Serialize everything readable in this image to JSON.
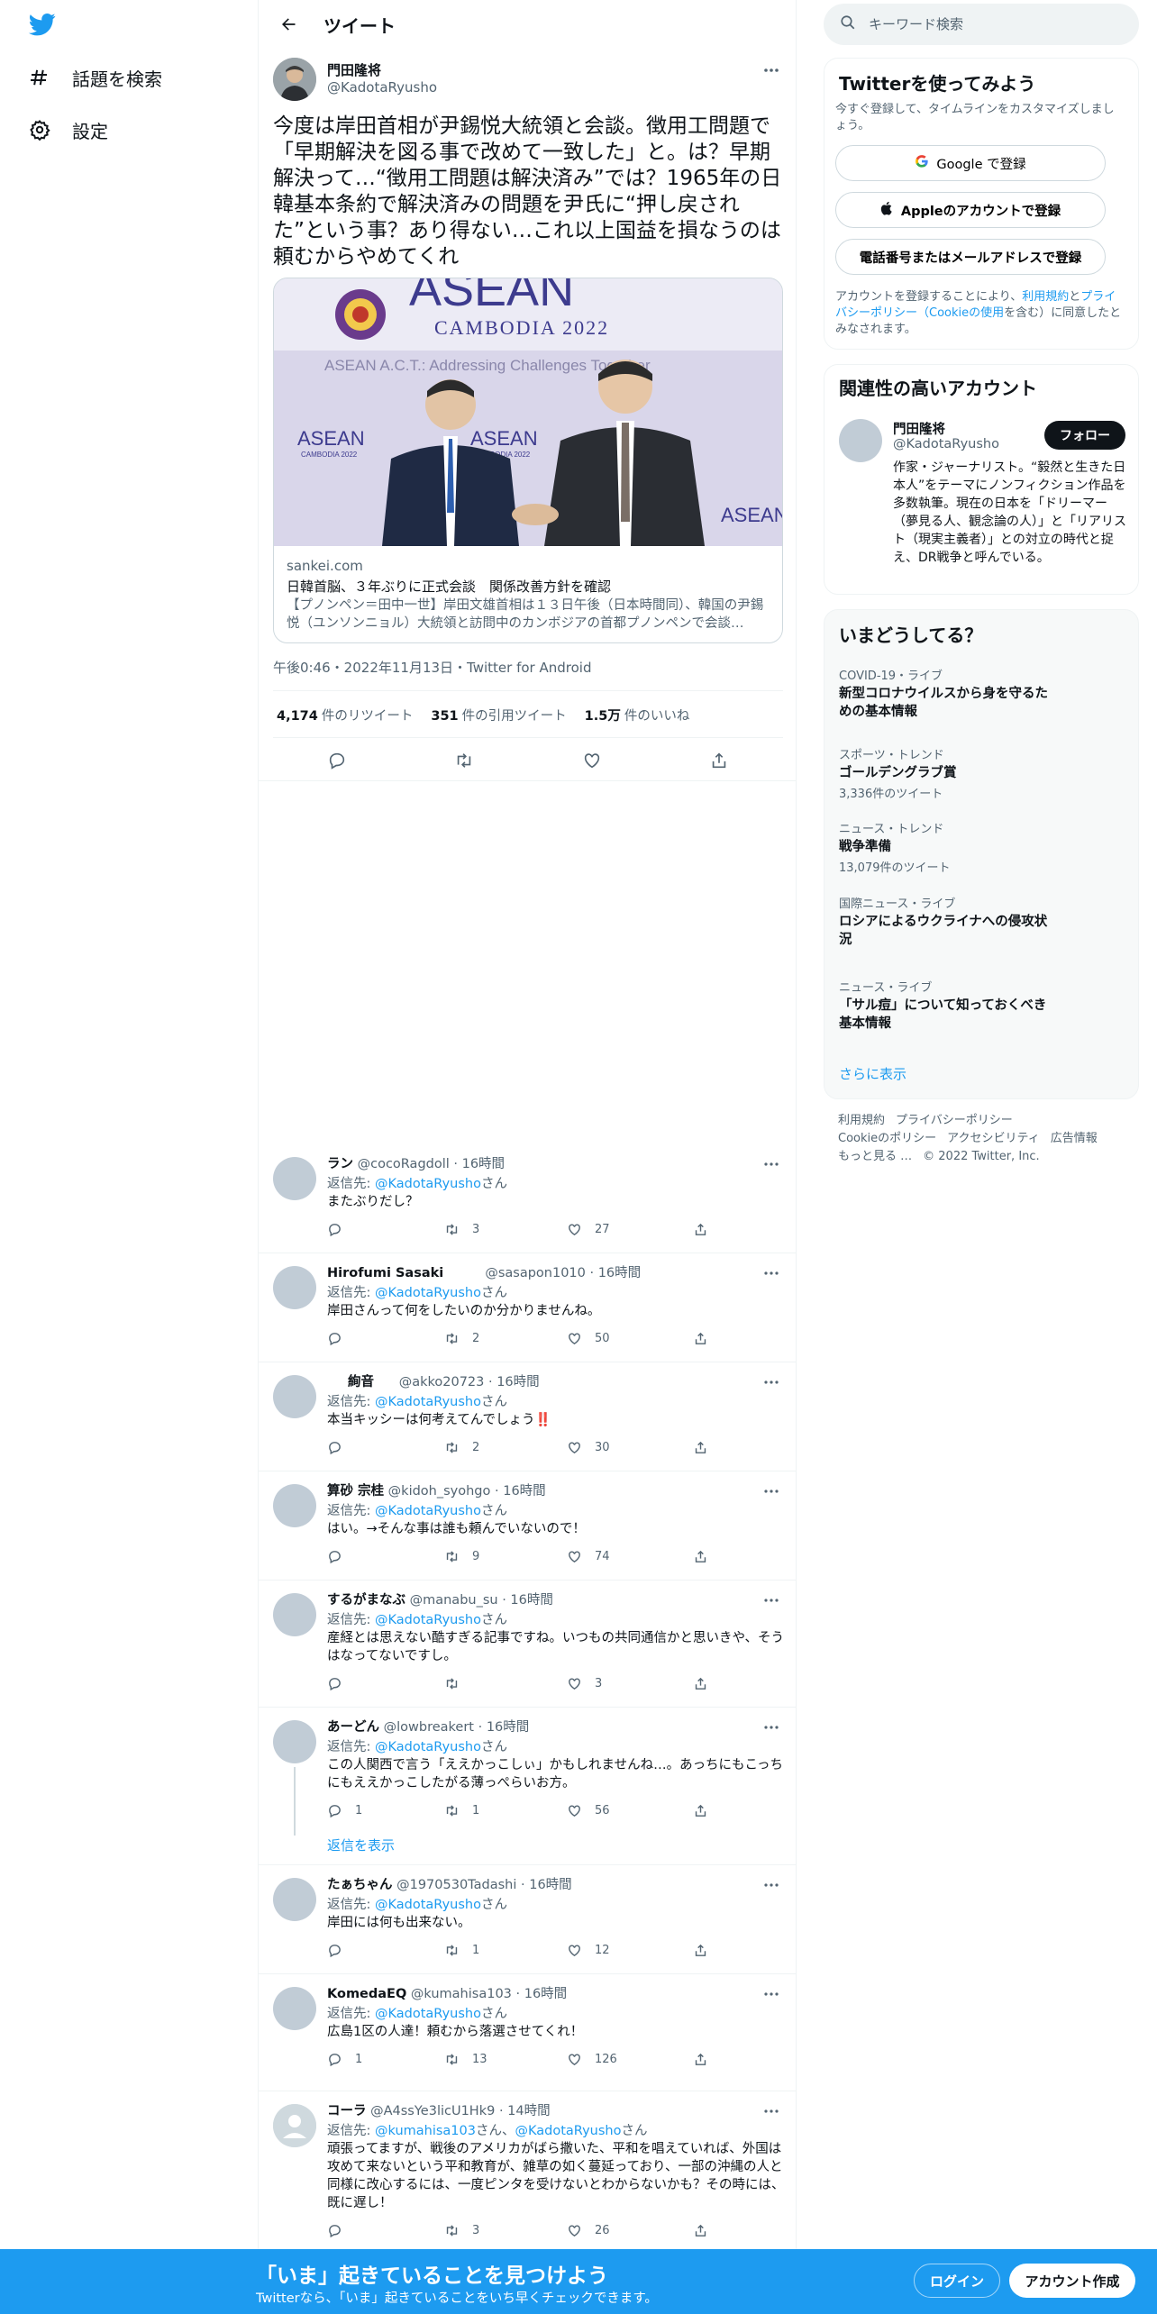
{
  "nav": {
    "explore": "話題を検索",
    "settings": "設定"
  },
  "header": {
    "title": "ツイート"
  },
  "tweet": {
    "author_name": "門田隆将",
    "author_handle": "@KadotaRyusho",
    "text": "今度は岸田首相が尹錫悦大統領と会談。徴用工問題で「早期解決を図る事で改めて一致した」と。は？早期解決って…“徴用工問題は解決済み”では？1965年の日韓基本条約で解決済みの問題を尹氏に“押し戻された”という事？あり得ない…これ以上国益を損なうのは頼むからやめてくれ",
    "card": {
      "banner_title": "ASEAN",
      "banner_sub": "CAMBODIA 2022",
      "banner_tagline": "ASEAN A.C.T.: Addressing Challenges Together",
      "backdrop_label": "ASEAN",
      "backdrop_sub": "CAMBODIA 2022",
      "domain": "sankei.com",
      "title": "日韓首脳、３年ぶりに正式会談　関係改善方針を確認",
      "description": "【プノンペン＝田中一世】岸田文雄首相は１３日午後（日本時間同）、韓国の尹錫悦（ユンソンニョル）大統領と訪問中のカンボジアの首都プノンペンで会談…"
    },
    "timestamp": "午後0:46・2022年11月13日・Twitter for Android",
    "stats": {
      "retweets": "4,174",
      "retweets_label": "件のリツイート",
      "quotes": "351",
      "quotes_label": "件の引用ツイート",
      "likes": "1.5万",
      "likes_label": "件のいいね"
    }
  },
  "replies": [
    {
      "name": "ラン",
      "handle": "@cocoRagdoll",
      "time": "16時間",
      "to_prefix": "返信先: ",
      "to": "@KadotaRyusho",
      "to_suffix": "さん",
      "text": "またぶりだし？",
      "replies": "",
      "retweets": "3",
      "likes": "27"
    },
    {
      "name": "Hirofumi Sasaki",
      "handle": "@sasapon1010",
      "time": "16時間",
      "to_prefix": "返信先: ",
      "to": "@KadotaRyusho",
      "to_suffix": "さん",
      "text": "岸田さんって何をしたいのか分かりませんね。",
      "replies": "",
      "retweets": "2",
      "likes": "50"
    },
    {
      "name": "絢音",
      "handle": "@akko20723",
      "time": "16時間",
      "to_prefix": "返信先: ",
      "to": "@KadotaRyusho",
      "to_suffix": "さん",
      "text": "本当キッシーは何考えてんでしょう‼️",
      "replies": "",
      "retweets": "2",
      "likes": "30"
    },
    {
      "name": "算砂 宗桂",
      "handle": "@kidoh_syohgo",
      "time": "16時間",
      "to_prefix": "返信先: ",
      "to": "@KadotaRyusho",
      "to_suffix": "さん",
      "text": "はい。→そんな事は誰も頼んでいないので！",
      "replies": "",
      "retweets": "9",
      "likes": "74"
    },
    {
      "name": "するがまなぶ",
      "handle": "@manabu_su",
      "time": "16時間",
      "to_prefix": "返信先: ",
      "to": "@KadotaRyusho",
      "to_suffix": "さん",
      "text": "産経とは思えない酷すぎる記事ですね。いつもの共同通信かと思いきや、そうはなってないですし。",
      "replies": "",
      "retweets": "",
      "likes": "3"
    },
    {
      "name": "あーどん",
      "handle": "@lowbreakert",
      "time": "16時間",
      "to_prefix": "返信先: ",
      "to": "@KadotaRyusho",
      "to_suffix": "さん",
      "text": "この人関西で言う「ええかっこしぃ」かもしれませんね…。あっちにもこっちにもええかっこしたがる薄っぺらいお方。",
      "replies": "1",
      "retweets": "1",
      "likes": "56"
    },
    {
      "name": "たぁちゃん",
      "handle": "@1970530Tadashi",
      "time": "16時間",
      "to_prefix": "返信先: ",
      "to": "@KadotaRyusho",
      "to_suffix": "さん",
      "text": "岸田には何も出来ない。",
      "replies": "",
      "retweets": "1",
      "likes": "12"
    },
    {
      "name": "KomedaEQ",
      "handle": "@kumahisa103",
      "time": "16時間",
      "to_prefix": "返信先: ",
      "to": "@KadotaRyusho",
      "to_suffix": "さん",
      "text": "広島1区の人達！頼むから落選させてくれ！",
      "replies": "1",
      "retweets": "13",
      "likes": "126"
    },
    {
      "name": "コーラ",
      "handle": "@A4ssYe3licU1Hk9",
      "time": "14時間",
      "to_prefix": "返信先: ",
      "to": "@kumahisa103",
      "to_mid": "さん、",
      "to2": "@KadotaRyusho",
      "to_suffix": "さん",
      "text": "頑張ってますが、戦後のアメリカがばら撒いた、平和を唱えていれば、外国は攻めて来ないという平和教育が、雑草の如く蔓延っており、一部の沖縄の人と同様に改心するには、一度ピンタを受けないとわからないかも？その時には、既に遅し！",
      "replies": "",
      "retweets": "3",
      "likes": "26"
    }
  ],
  "show_replies": "返信を表示",
  "right": {
    "search_placeholder": "キーワード検索",
    "signup_title": "Twitterを使ってみよう",
    "signup_desc": "今すぐ登録して、タイムラインをカスタマイズしましょう。",
    "google_btn": "Google で登録",
    "apple_btn": "Appleのアカウントで登録",
    "phone_btn": "電話番号またはメールアドレスで登録",
    "terms_pre": "アカウントを登録することにより、",
    "terms_link1": "利用規約",
    "terms_mid": "と",
    "terms_link2": "プライバシーポリシー（Cookieの使用",
    "terms_post": "を含む）に同意したとみなされます。",
    "related_title": "関連性の高いアカウント",
    "related_name": "門田隆将",
    "related_handle": "@KadotaRyusho",
    "follow_btn": "フォロー",
    "related_bio": "作家・ジャーナリスト。“毅然と生きた日本人”をテーマにノンフィクション作品を多数執筆。現在の日本を「ドリーマー（夢見る人、観念論の人）」と「リアリスト（現実主義者）」との対立の時代と捉え、DR戦争と呼んでいる。",
    "trends_title": "いまどうしてる？",
    "trends": [
      {
        "category": "COVID-19・ライブ",
        "title": "新型コロナウイルスから身を守るための基本情報",
        "count": ""
      },
      {
        "category": "スポーツ・トレンド",
        "title": "ゴールデングラブ賞",
        "count": "3,336件のツイート"
      },
      {
        "category": "ニュース・トレンド",
        "title": "戦争準備",
        "count": "13,079件のツイート"
      },
      {
        "category": "国際ニュース・ライブ",
        "title": "ロシアによるウクライナへの侵攻状況",
        "count": ""
      },
      {
        "category": "ニュース・ライブ",
        "title": "「サル痘」について知っておくべき基本情報",
        "count": ""
      }
    ],
    "show_more": "さらに表示",
    "footer": {
      "terms": "利用規約",
      "privacy": "プライバシーポリシー",
      "cookie": "Cookieのポリシー",
      "accessibility": "アクセシビリティ",
      "ads": "広告情報",
      "more": "もっと見る …",
      "copyright": "© 2022 Twitter, Inc."
    }
  },
  "bottom": {
    "title": "「いま」起きていることを見つけよう",
    "subtitle": "Twitterなら、「いま」起きていることをいち早くチェックできます。",
    "login": "ログイン",
    "signup": "アカウント作成"
  },
  "colors": {
    "accent": "#1d9bf0",
    "text": "#0f1419",
    "secondary": "#536471",
    "border": "#eff3f4"
  }
}
